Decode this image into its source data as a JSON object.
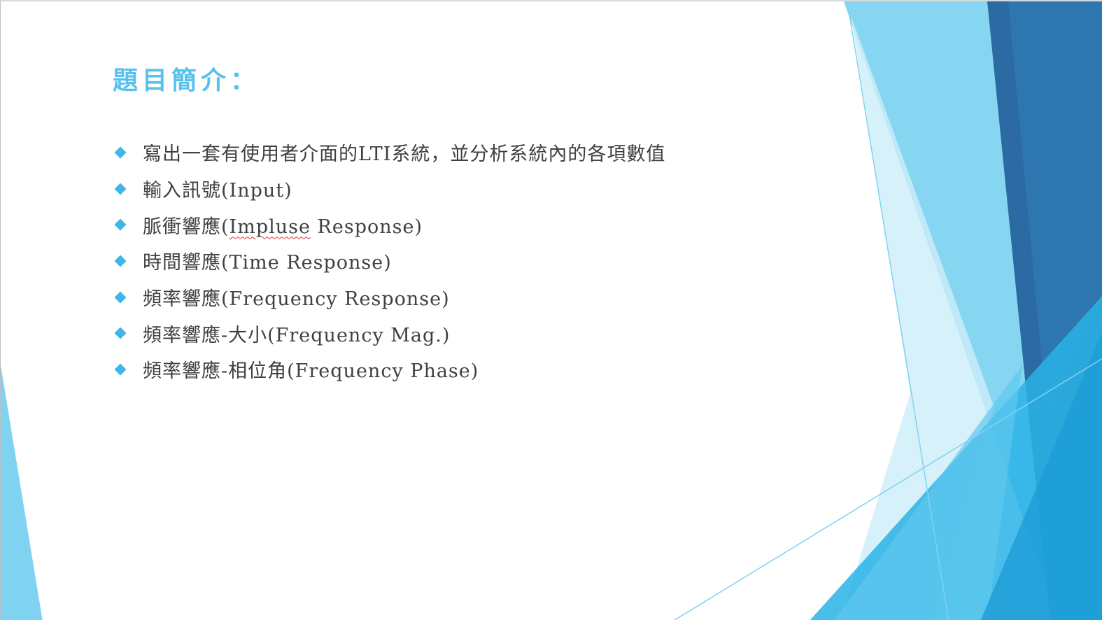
{
  "slide": {
    "title": "題目簡介：",
    "bullets": [
      {
        "text": "寫出一套有使用者介面的LTI系統，並分析系統內的各項數值"
      },
      {
        "text_before": "脈衝響應(",
        "text_flagged": "Impluse",
        "text_after": " Response)"
      },
      {
        "text": "輸入訊號(Input)"
      },
      {
        "text": "時間響應(Time Response)"
      },
      {
        "text": "頻率響應(Frequency Response)"
      },
      {
        "text": "頻率響應-大小(Frequency Mag.)"
      },
      {
        "text": "頻率響應-相位角(Frequency Phase)"
      }
    ],
    "colors": {
      "title": "#56c2ee",
      "bullet_marker": "#3fb6e9",
      "body_text": "#404040",
      "accent_light": "#7fd3f0",
      "accent_mid": "#2ab3e6",
      "accent_dark": "#2b6aa3"
    },
    "icons": {
      "bullet_marker": "diamond-icon"
    }
  }
}
